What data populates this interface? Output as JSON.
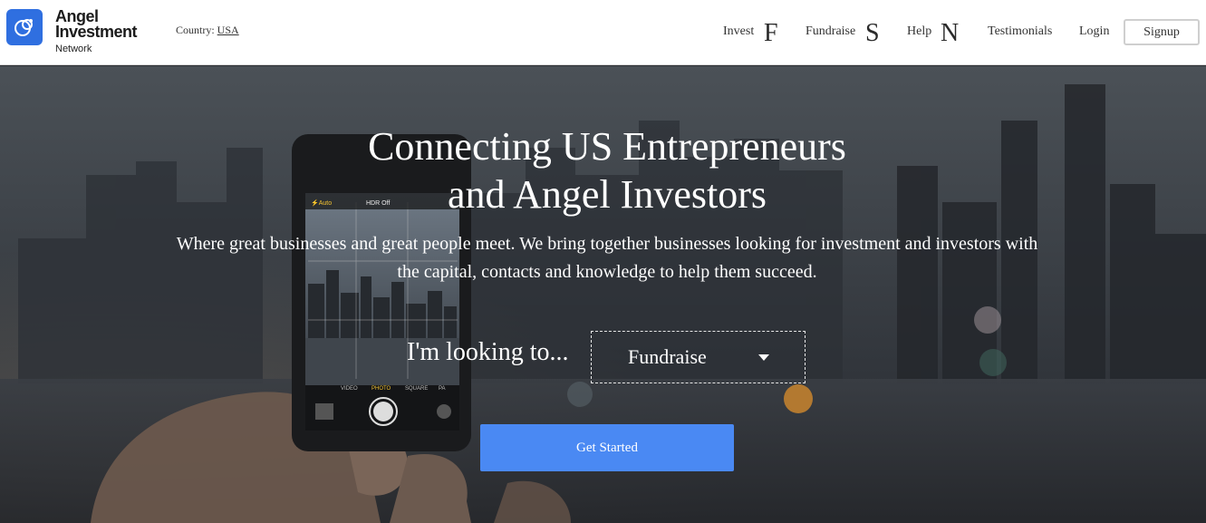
{
  "brand": {
    "line1": "Angel",
    "line2": "Investment",
    "line3": "Network",
    "color": "#2f6fe0",
    "logo_icon": "angel-logo-icon"
  },
  "country": {
    "label": "Country:",
    "value": "USA"
  },
  "nav": {
    "invest": {
      "label": "Invest",
      "glyph": "F"
    },
    "fundraise": {
      "label": "Fundraise",
      "glyph": "S"
    },
    "help": {
      "label": "Help",
      "glyph": "N"
    },
    "testimonials": "Testimonials",
    "login": "Login",
    "signup": "Signup"
  },
  "hero": {
    "title_line1": "Connecting US Entrepreneurs",
    "title_line2": "and Angel Investors",
    "subtitle": "Where great businesses and great people meet. We bring together businesses looking for investment and investors with the capital, contacts and knowledge to help them succeed.",
    "looking_label": "I'm looking to...",
    "select_value": "Fundraise",
    "cta": "Get Started",
    "cta_color": "#4a89f3"
  },
  "phone_ui": {
    "flash": "⚡Auto",
    "hdr": "HDR Off",
    "modes": [
      "VIDEO",
      "PHOTO",
      "SQUARE",
      "PA"
    ]
  }
}
